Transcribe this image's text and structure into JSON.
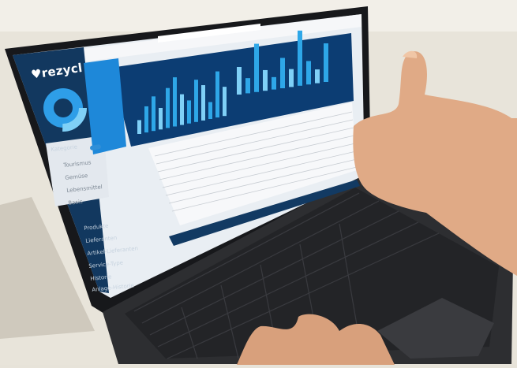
{
  "photo": {
    "subject": "tablet-keyboard-with-thumbs-up",
    "colors": {
      "table_surface": "#e7e3d9",
      "device_frame": "#1c1d20",
      "keyboard": "#2b2c2f",
      "screen_sidebar": "#123a63",
      "screen_accent": "#1e88d9",
      "screen_chart_bg": "#0d3d74",
      "bar_color": "#2ea7e8",
      "skin": "#e2b08d"
    }
  },
  "screen": {
    "brand": "♥rezycl",
    "sidebar_heading": "Kategorie",
    "sidebar_items_light": [
      "Tourismus",
      "Gemüse",
      "Lebensmittel",
      "Basis"
    ],
    "sidebar_items_dark": [
      "Produkte",
      "Lieferanten",
      "Artikel-Lieferanten",
      "Service-Type",
      "Historie",
      "Anlage-Historie"
    ],
    "chart_data": {
      "type": "bar",
      "series": [
        {
          "values": [
            18,
            34,
            45,
            28,
            52,
            64,
            40,
            30,
            55,
            46,
            22,
            60,
            38
          ]
        },
        {
          "values": [
            40,
            22,
            70,
            30,
            18,
            44,
            26,
            80,
            34,
            20,
            56
          ]
        }
      ]
    }
  }
}
